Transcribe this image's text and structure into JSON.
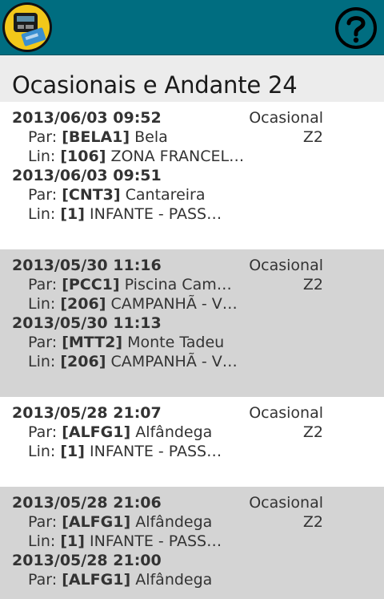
{
  "screen_title": "Ocasionais e Andante 24",
  "labels": {
    "stop_prefix": "Par:",
    "line_prefix": "Lin:"
  },
  "cards": [
    {
      "type": "Ocasional",
      "zone": "Z2",
      "trips": [
        {
          "datetime": "2013/06/03 09:52",
          "stop_code": "[BELA1]",
          "stop_name": "Bela",
          "line_code": "[106]",
          "line_name": "ZONA FRANCEL…"
        },
        {
          "datetime": "2013/06/03 09:51",
          "stop_code": "[CNT3]",
          "stop_name": "Cantareira",
          "line_code": "[1]",
          "line_name": "INFANTE - PASS…"
        }
      ]
    },
    {
      "type": "Ocasional",
      "zone": "Z2",
      "trips": [
        {
          "datetime": "2013/05/30 11:16",
          "stop_code": "[PCC1]",
          "stop_name": "Piscina Cam…",
          "line_code": "[206]",
          "line_name": "CAMPANHÃ - V…"
        },
        {
          "datetime": "2013/05/30 11:13",
          "stop_code": "[MTT2]",
          "stop_name": "Monte Tadeu",
          "line_code": "[206]",
          "line_name": "CAMPANHÃ - V…"
        }
      ]
    },
    {
      "type": "Ocasional",
      "zone": "Z2",
      "trips": [
        {
          "datetime": "2013/05/28 21:07",
          "stop_code": "[ALFG1]",
          "stop_name": "Alfândega",
          "line_code": "[1]",
          "line_name": "INFANTE - PASS…"
        }
      ]
    },
    {
      "type": "Ocasional",
      "zone": "Z2",
      "trips": [
        {
          "datetime": "2013/05/28 21:06",
          "stop_code": "[ALFG1]",
          "stop_name": "Alfândega",
          "line_code": "[1]",
          "line_name": "INFANTE - PASS…"
        },
        {
          "datetime": "2013/05/28 21:00",
          "stop_code": "[ALFG1]",
          "stop_name": "Alfândega",
          "line_code": "",
          "line_name": ""
        }
      ]
    }
  ],
  "colors": {
    "topbar": "#006d80",
    "title_bar": "#ececec",
    "card_alt": "#d4d4d4",
    "icon_yellow": "#f2c81a"
  },
  "icons": {
    "app": "andante-card-app-icon",
    "help": "help-icon"
  }
}
